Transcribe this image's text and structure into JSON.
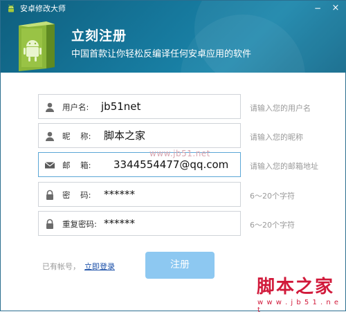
{
  "window": {
    "title": "安卓修改大师",
    "minimize_glyph": "−",
    "close_glyph": "×"
  },
  "header": {
    "title": "立刻注册",
    "subtitle": "中国首款让你轻松反编译任何安卓应用的软件"
  },
  "form": {
    "fields": [
      {
        "icon": "user-icon",
        "label": "用户名:",
        "value": "jb51net",
        "hint": "请输入您的用户名"
      },
      {
        "icon": "user-icon",
        "label": "昵    称:",
        "value": "脚本之家",
        "hint": "请输入您的昵称"
      },
      {
        "icon": "mail-icon",
        "label": "邮    箱:",
        "value": "3344554477@qq.com",
        "hint": "请输入您的邮箱地址"
      },
      {
        "icon": "lock-icon",
        "label": "密    码:",
        "value": "******",
        "hint": "6～20个字符"
      },
      {
        "icon": "lock-icon",
        "label": "重复密码:",
        "value": "******",
        "hint": "6～20个字符"
      }
    ],
    "have_account": "已有帐号，",
    "login_link": "立即登录",
    "register_button": "注册"
  },
  "watermark": {
    "url": "www.jb51.net",
    "logo": "脚本之家",
    "logo_url": "w w w . j b 5 1 . n e t"
  },
  "colors": {
    "header": "#157599",
    "register_button": "#8dc8f1",
    "link": "#1a4fa8",
    "hint": "#9a9a9a",
    "watermark": "#d1193a"
  }
}
